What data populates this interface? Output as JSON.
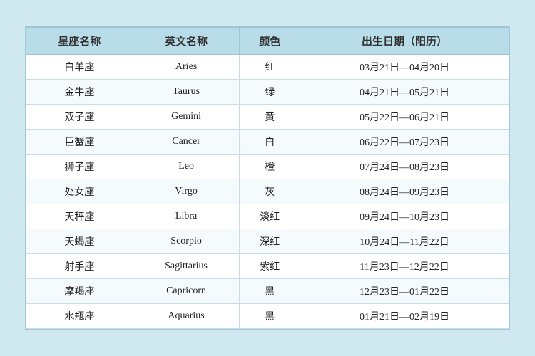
{
  "table": {
    "headers": [
      "星座名称",
      "英文名称",
      "颜色",
      "出生日期（阳历）"
    ],
    "rows": [
      [
        "白羊座",
        "Aries",
        "红",
        "03月21日—04月20日"
      ],
      [
        "金牛座",
        "Taurus",
        "绿",
        "04月21日—05月21日"
      ],
      [
        "双子座",
        "Gemini",
        "黄",
        "05月22日—06月21日"
      ],
      [
        "巨蟹座",
        "Cancer",
        "白",
        "06月22日—07月23日"
      ],
      [
        "狮子座",
        "Leo",
        "橙",
        "07月24日—08月23日"
      ],
      [
        "处女座",
        "Virgo",
        "灰",
        "08月24日—09月23日"
      ],
      [
        "天秤座",
        "Libra",
        "淡红",
        "09月24日—10月23日"
      ],
      [
        "天蝎座",
        "Scorpio",
        "深红",
        "10月24日—11月22日"
      ],
      [
        "射手座",
        "Sagittarius",
        "紫红",
        "11月23日—12月22日"
      ],
      [
        "摩羯座",
        "Capricorn",
        "黑",
        "12月23日—01月22日"
      ],
      [
        "水瓶座",
        "Aquarius",
        "黑",
        "01月21日—02月19日"
      ]
    ]
  }
}
